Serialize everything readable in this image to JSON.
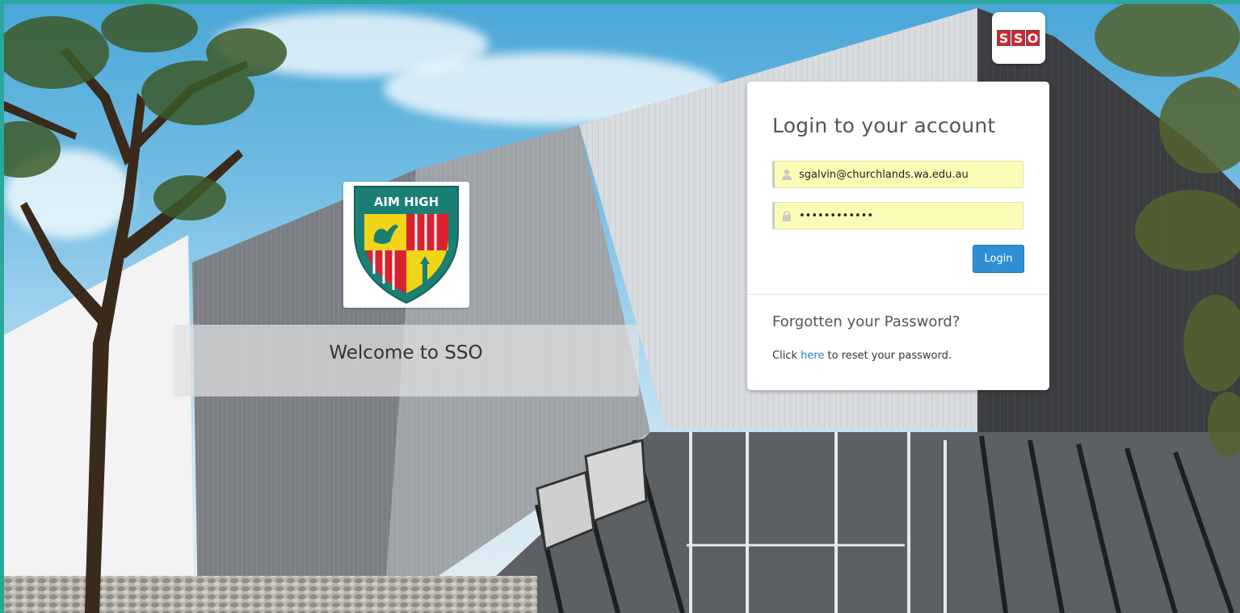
{
  "welcome": {
    "heading": "Welcome to SSO",
    "crest_motto": "AIM HIGH"
  },
  "badge": {
    "letters": [
      "S",
      "S",
      "O"
    ]
  },
  "login": {
    "title": "Login to your account",
    "username_value": "sgalvin@churchlands.wa.edu.au",
    "password_value": "••••••••••••",
    "button_label": "Login"
  },
  "forgot": {
    "title": "Forgotten your Password?",
    "text_before": "Click ",
    "link_label": "here",
    "text_after": " to reset your password."
  },
  "colors": {
    "frame": "#2ba79c",
    "button": "#2f8fd4",
    "autofill": "#fbfdb7",
    "link": "#2f7fc4",
    "badge_red": "#d7232f"
  },
  "icons": {
    "username": "user-icon",
    "password": "lock-icon"
  }
}
